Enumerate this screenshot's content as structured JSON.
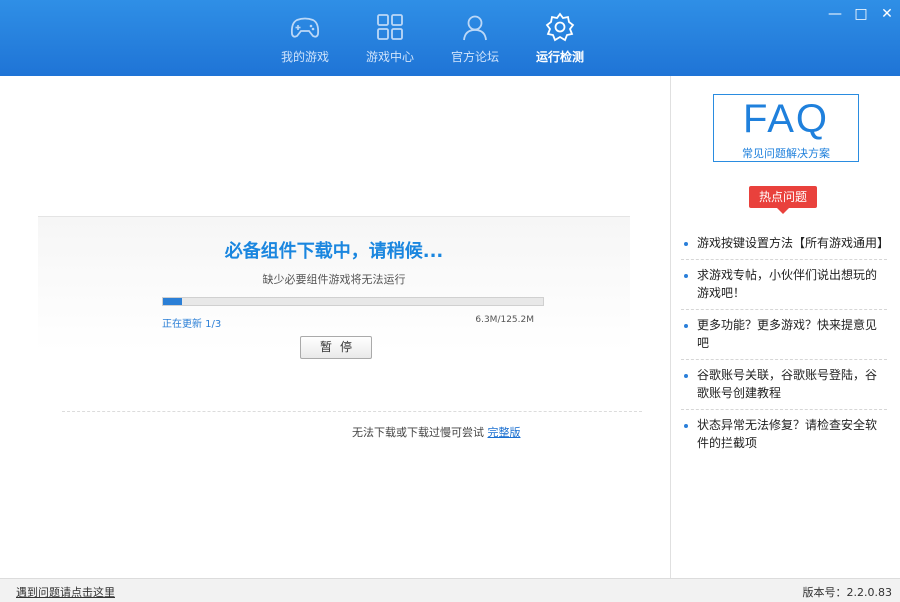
{
  "window": {
    "min_label": "—",
    "max_label": "□",
    "close_label": "✕"
  },
  "nav": {
    "items": [
      {
        "label": "我的游戏",
        "icon": "gamepad-icon"
      },
      {
        "label": "游戏中心",
        "icon": "grid-icon"
      },
      {
        "label": "官方论坛",
        "icon": "user-icon"
      },
      {
        "label": "运行检测",
        "icon": "gear-icon",
        "active": true
      }
    ]
  },
  "download": {
    "title": "必备组件下载中，请稍候...",
    "subtitle": "缺少必要组件游戏将无法运行",
    "progress_fraction": 0.05,
    "status": "正在更新  1/3",
    "size": "6.3M/125.2M",
    "pause_label": "暂停",
    "alt_text": "无法下载或下载过慢可尝试",
    "alt_link": "完整版"
  },
  "sidebar": {
    "faq_big": "FAQ",
    "faq_small": "常见问题解决方案",
    "hot_tag": "热点问题",
    "hot_items": [
      "游戏按键设置方法【所有游戏通用】",
      "求游戏专帖，小伙伴们说出想玩的游戏吧！",
      "更多功能？更多游戏？快来提意见吧",
      "谷歌账号关联，谷歌账号登陆，谷歌账号创建教程",
      "状态异常无法修复？请检查安全软件的拦截项"
    ]
  },
  "footer": {
    "left": "遇到问题请点击这里",
    "version": "版本号：2.2.0.83"
  },
  "colors": {
    "header_blue": "#2580dc",
    "accent_blue": "#1a86df",
    "hot_red": "#e9413c"
  }
}
